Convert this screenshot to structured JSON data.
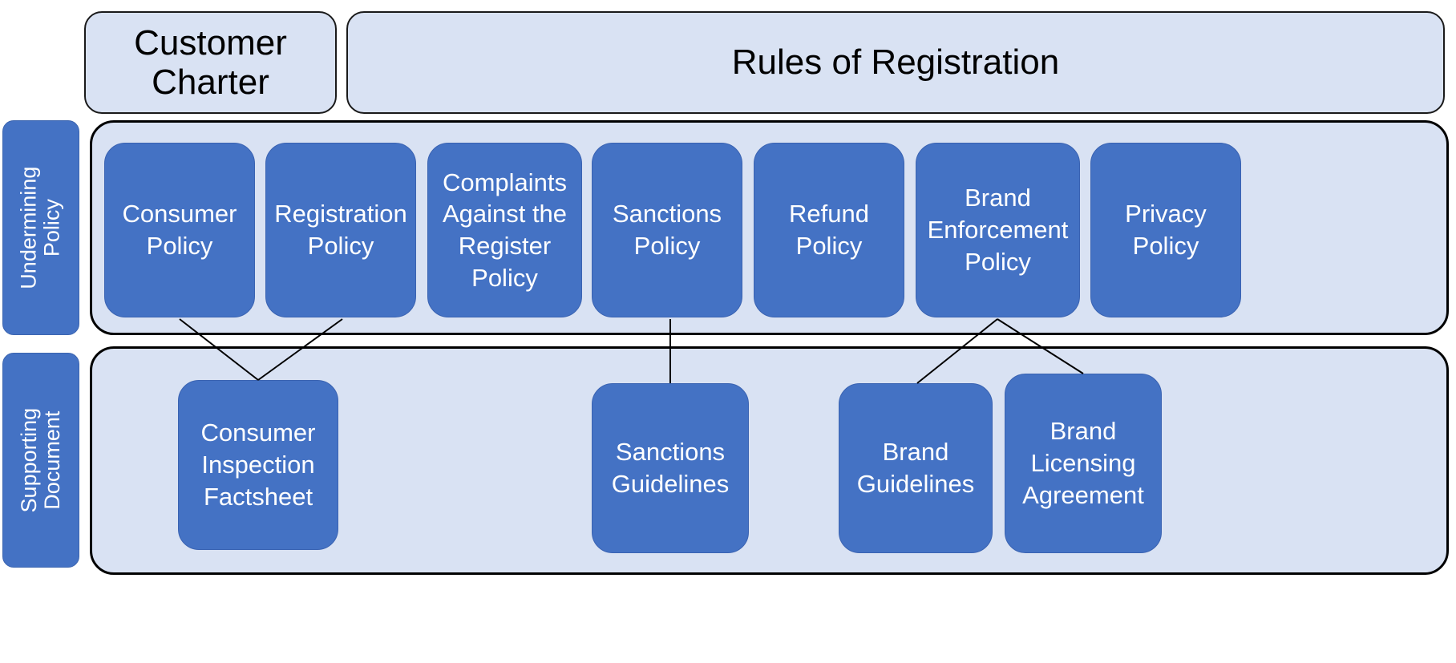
{
  "diagram": {
    "title_boxes": [
      {
        "id": "customer-charter",
        "label": "Customer\nCharter"
      },
      {
        "id": "rules-of-registration",
        "label": "Rules of Registration"
      }
    ],
    "rails": [
      {
        "id": "undermining-policy",
        "line1": "Undermining",
        "line2": "Policy"
      },
      {
        "id": "supporting-document",
        "line1": "Supporting",
        "line2": "Document"
      }
    ],
    "policy_row": {
      "name": "Undermining Policy",
      "nodes": [
        {
          "id": "consumer-policy",
          "label": "Consumer\nPolicy"
        },
        {
          "id": "registration-policy",
          "label": "Registration\nPolicy"
        },
        {
          "id": "complaints-against-the-register-policy",
          "label": "Complaints\nAgainst the\nRegister\nPolicy"
        },
        {
          "id": "sanctions-policy",
          "label": "Sanctions\nPolicy"
        },
        {
          "id": "refund-policy",
          "label": "Refund\nPolicy"
        },
        {
          "id": "brand-enforcement-policy",
          "label": "Brand\nEnforcement\nPolicy"
        },
        {
          "id": "privacy-policy",
          "label": "Privacy\nPolicy"
        }
      ]
    },
    "document_row": {
      "name": "Supporting Document",
      "nodes": [
        {
          "id": "consumer-inspection-factsheet",
          "label": "Consumer\nInspection\nFactsheet"
        },
        {
          "id": "sanctions-guidelines",
          "label": "Sanctions\nGuidelines"
        },
        {
          "id": "brand-guidelines",
          "label": "Brand\nGuidelines"
        },
        {
          "id": "brand-licensing-agreement",
          "label": "Brand\nLicensing\nAgreement"
        }
      ]
    },
    "connections": [
      {
        "from": "consumer-policy",
        "to": "consumer-inspection-factsheet"
      },
      {
        "from": "registration-policy",
        "to": "consumer-inspection-factsheet"
      },
      {
        "from": "sanctions-policy",
        "to": "sanctions-guidelines"
      },
      {
        "from": "brand-enforcement-policy",
        "to": "brand-guidelines"
      },
      {
        "from": "brand-enforcement-policy",
        "to": "brand-licensing-agreement"
      }
    ],
    "colors": {
      "node_fill": "#4472C4",
      "panel_fill": "#D9E2F3",
      "node_text": "#FFFFFF",
      "header_text": "#000000",
      "outline": "#000000"
    }
  }
}
